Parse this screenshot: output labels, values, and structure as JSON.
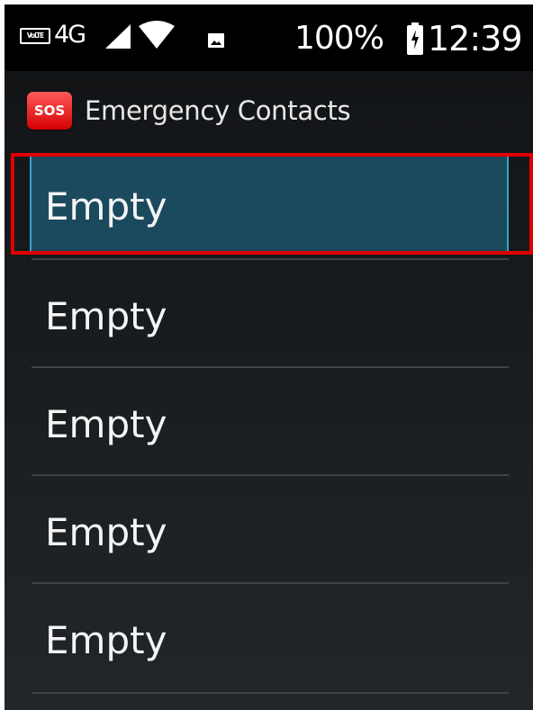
{
  "status_bar": {
    "volte_label": "VoLTE",
    "network_type": "4G",
    "signal_icon": "signal-icon",
    "wifi_icon": "wifi-icon",
    "notification_icon": "image-icon",
    "battery_percent": "100%",
    "battery_icon": "battery-charging-icon",
    "time": "12:39"
  },
  "app_bar": {
    "icon_text": "SOS",
    "title": "Emergency Contacts",
    "icon_color": "#e02020"
  },
  "contacts": {
    "items": [
      {
        "label": "Empty",
        "selected": true
      },
      {
        "label": "Empty",
        "selected": false
      },
      {
        "label": "Empty",
        "selected": false
      },
      {
        "label": "Empty",
        "selected": false
      },
      {
        "label": "Empty",
        "selected": false
      }
    ]
  },
  "colors": {
    "selection_bg": "#1b4a5e",
    "highlight_border": "#e00000"
  }
}
